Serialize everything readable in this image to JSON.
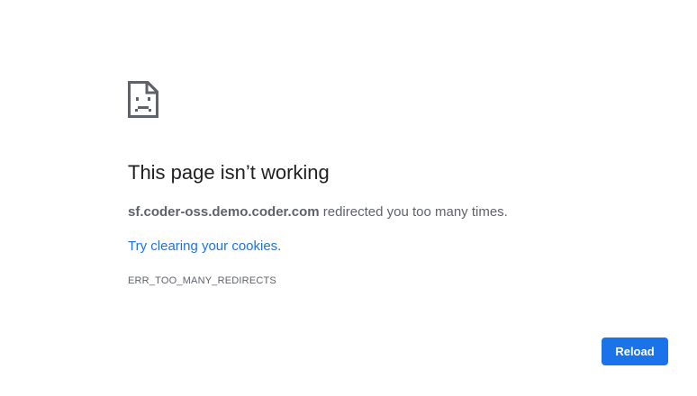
{
  "error": {
    "icon": "sad-page-icon",
    "title": "This page isn’t working",
    "host": "sf.coder-oss.demo.coder.com",
    "message_suffix": " redirected you too many times.",
    "suggestion_link": "Try clearing your cookies",
    "suggestion_suffix": ".",
    "code": "ERR_TOO_MANY_REDIRECTS"
  },
  "actions": {
    "reload_label": "Reload"
  },
  "colors": {
    "accent": "#1a73e8",
    "title": "#202124",
    "text": "#5f6368"
  }
}
